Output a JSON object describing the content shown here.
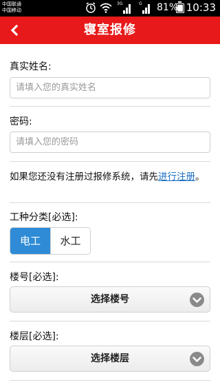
{
  "status_bar": {
    "carrier_1": "中国联通",
    "carrier_2": "中国移动",
    "net_1": "3G",
    "net_2": "G",
    "battery": "81%",
    "time": "10:33"
  },
  "header": {
    "title": "寝室报修",
    "back_icon": "chevron-left-icon",
    "color": "#e8191a"
  },
  "form": {
    "name_label": "真实姓名:",
    "name_placeholder": "请填入您的真实姓名",
    "password_label": "密码:",
    "password_placeholder": "请填入您的密码",
    "notice_text": "如果您还没有注册过报修系统，请先",
    "notice_link": "进行注册",
    "notice_end": "。",
    "work_type_label": "工种分类[必选]:",
    "work_types": [
      "电工",
      "水工"
    ],
    "work_type_selected": "电工",
    "building_label": "楼号[必选]:",
    "building_select": "选择楼号",
    "floor_label": "楼层[必选]:",
    "floor_select": "选择楼层"
  },
  "accent": "#2f8bd6",
  "link_color": "#1b6fc2"
}
